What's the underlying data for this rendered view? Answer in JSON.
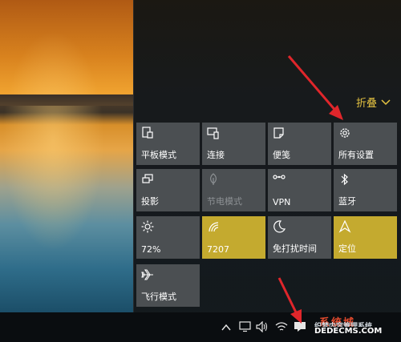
{
  "action_center": {
    "collapse_label": "折叠",
    "tiles": [
      {
        "label": "平板模式",
        "icon": "tablet-mode-icon",
        "state": "normal"
      },
      {
        "label": "连接",
        "icon": "connect-icon",
        "state": "normal"
      },
      {
        "label": "便笺",
        "icon": "note-icon",
        "state": "normal"
      },
      {
        "label": "所有设置",
        "icon": "gear-icon",
        "state": "normal"
      },
      {
        "label": "投影",
        "icon": "project-icon",
        "state": "normal"
      },
      {
        "label": "节电模式",
        "icon": "battery-saver-icon",
        "state": "disabled"
      },
      {
        "label": "VPN",
        "icon": "vpn-icon",
        "state": "normal"
      },
      {
        "label": "蓝牙",
        "icon": "bluetooth-icon",
        "state": "normal"
      },
      {
        "label": "72%",
        "icon": "brightness-icon",
        "state": "normal"
      },
      {
        "label": "7207",
        "icon": "wifi-icon",
        "state": "active"
      },
      {
        "label": "免打扰时间",
        "icon": "moon-icon",
        "state": "normal"
      },
      {
        "label": "定位",
        "icon": "location-icon",
        "state": "active"
      },
      {
        "label": "飞行模式",
        "icon": "airplane-icon",
        "state": "normal"
      }
    ]
  },
  "taskbar": {
    "tray_icons": [
      "chevron-up-icon",
      "monitor-icon",
      "volume-icon",
      "wifi-icon",
      "notification-icon"
    ]
  },
  "watermark": {
    "line1": "系统城",
    "line2": "DEDECMS.COM",
    "line3": "织梦内容管理系统"
  },
  "colors": {
    "tile": "#4b4f52",
    "accent": "#c4aa2f",
    "collapse_text": "#e5c341",
    "arrow": "#e0262b"
  }
}
